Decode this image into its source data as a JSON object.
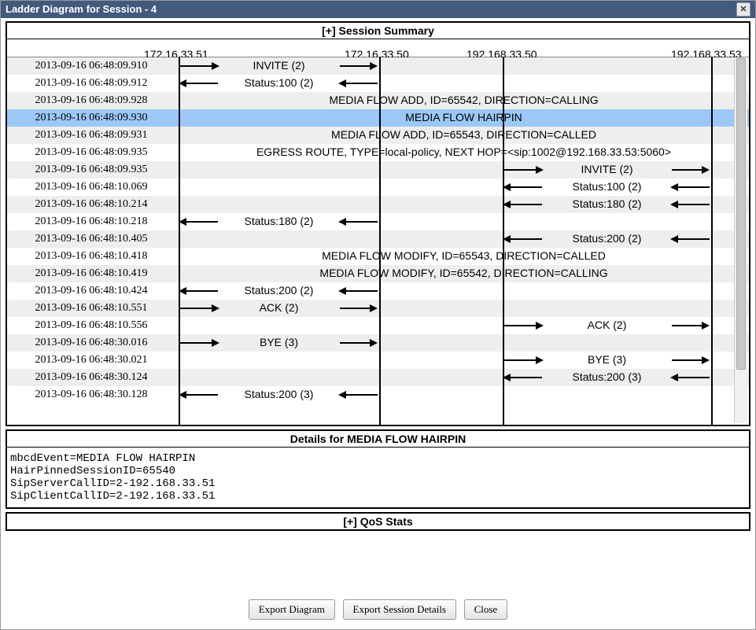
{
  "window": {
    "title": "Ladder Diagram for Session - 4"
  },
  "session_summary_header": "[+] Session Summary",
  "qos_header": "[+] QoS Stats",
  "columns": {
    "c1": "172.16.33.51",
    "c2": "172.16.33.50",
    "c3": "192.168.33.50",
    "c4": "192.168.33.53"
  },
  "rows": [
    {
      "ts": "2013-09-16 06:48:09.910",
      "type": "msg",
      "from": 1,
      "to": 2,
      "label": "INVITE (2)"
    },
    {
      "ts": "2013-09-16 06:48:09.912",
      "type": "msg",
      "from": 2,
      "to": 1,
      "label": "Status:100 (2)"
    },
    {
      "ts": "2013-09-16 06:48:09.928",
      "type": "full",
      "text": "MEDIA FLOW ADD, ID=65542, DIRECTION=CALLING"
    },
    {
      "ts": "2013-09-16 06:48:09.930",
      "type": "full",
      "text": "MEDIA FLOW HAIRPIN",
      "selected": true
    },
    {
      "ts": "2013-09-16 06:48:09.931",
      "type": "full",
      "text": "MEDIA FLOW ADD, ID=65543, DIRECTION=CALLED"
    },
    {
      "ts": "2013-09-16 06:48:09.935",
      "type": "full",
      "text": "EGRESS ROUTE, TYPE=local-policy, NEXT HOP=<sip:1002@192.168.33.53:5060>"
    },
    {
      "ts": "2013-09-16 06:48:09.935",
      "type": "msg",
      "from": 3,
      "to": 4,
      "label": "INVITE (2)"
    },
    {
      "ts": "2013-09-16 06:48:10.069",
      "type": "msg",
      "from": 4,
      "to": 3,
      "label": "Status:100 (2)"
    },
    {
      "ts": "2013-09-16 06:48:10.214",
      "type": "msg",
      "from": 4,
      "to": 3,
      "label": "Status:180 (2)"
    },
    {
      "ts": "2013-09-16 06:48:10.218",
      "type": "msg",
      "from": 2,
      "to": 1,
      "label": "Status:180 (2)"
    },
    {
      "ts": "2013-09-16 06:48:10.405",
      "type": "msg",
      "from": 4,
      "to": 3,
      "label": "Status:200 (2)"
    },
    {
      "ts": "2013-09-16 06:48:10.418",
      "type": "full",
      "text": "MEDIA FLOW MODIFY, ID=65543, DIRECTION=CALLED"
    },
    {
      "ts": "2013-09-16 06:48:10.419",
      "type": "full",
      "text": "MEDIA FLOW MODIFY, ID=65542, DIRECTION=CALLING"
    },
    {
      "ts": "2013-09-16 06:48:10.424",
      "type": "msg",
      "from": 2,
      "to": 1,
      "label": "Status:200 (2)"
    },
    {
      "ts": "2013-09-16 06:48:10.551",
      "type": "msg",
      "from": 1,
      "to": 2,
      "label": "ACK (2)"
    },
    {
      "ts": "2013-09-16 06:48:10.556",
      "type": "msg",
      "from": 3,
      "to": 4,
      "label": "ACK (2)"
    },
    {
      "ts": "2013-09-16 06:48:30.016",
      "type": "msg",
      "from": 1,
      "to": 2,
      "label": "BYE (3)"
    },
    {
      "ts": "2013-09-16 06:48:30.021",
      "type": "msg",
      "from": 3,
      "to": 4,
      "label": "BYE (3)"
    },
    {
      "ts": "2013-09-16 06:48:30.124",
      "type": "msg",
      "from": 4,
      "to": 3,
      "label": "Status:200 (3)"
    },
    {
      "ts": "2013-09-16 06:48:30.128",
      "type": "msg",
      "from": 2,
      "to": 1,
      "label": "Status:200 (3)"
    }
  ],
  "details": {
    "header": "Details for MEDIA FLOW HAIRPIN",
    "body": "mbcdEvent=MEDIA FLOW HAIRPIN\nHairPinnedSessionID=65540\nSipServerCallID=2-192.168.33.51\nSipClientCallID=2-192.168.33.51"
  },
  "buttons": {
    "export_diagram": "Export Diagram",
    "export_session": "Export Session Details",
    "close": "Close"
  }
}
